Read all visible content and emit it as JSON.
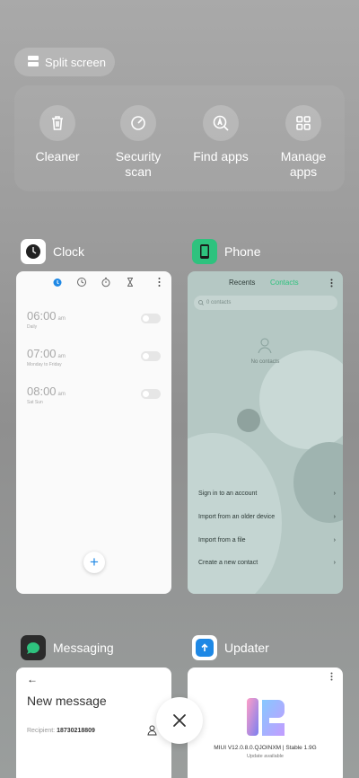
{
  "split_screen": {
    "label": "Split screen",
    "icon": "split-screen-icon"
  },
  "tools": [
    {
      "label": "Cleaner",
      "icon": "trash-icon"
    },
    {
      "label": "Security scan",
      "icon": "security-scan-icon"
    },
    {
      "label": "Find apps",
      "icon": "find-apps-icon"
    },
    {
      "label": "Manage apps",
      "icon": "grid-icon"
    }
  ],
  "apps": {
    "clock": {
      "name": "Clock",
      "alarms": [
        {
          "time": "06:00",
          "ampm": "am",
          "sub": "Daily"
        },
        {
          "time": "07:00",
          "ampm": "am",
          "sub": "Monday to Friday"
        },
        {
          "time": "08:00",
          "ampm": "am",
          "sub": "Sat Sun"
        }
      ],
      "fab": "+"
    },
    "phone": {
      "name": "Phone",
      "tab_recents": "Recents",
      "tab_contacts": "Contacts",
      "search_placeholder": "0 contacts",
      "empty": "No contacts",
      "rows": [
        "Sign in to an account",
        "Import from an older device",
        "Import from a file",
        "Create a new contact"
      ]
    },
    "messaging": {
      "name": "Messaging",
      "title": "New message",
      "recipient_label": "Recipient:",
      "recipient_value": "18730218809"
    },
    "updater": {
      "name": "Updater",
      "version": "MIUI V12.0.8.0.QJOINXM | Stable 1.9G",
      "status": "Update available"
    }
  },
  "colors": {
    "accent_green": "#2ec27e",
    "accent_blue": "#1e88e5"
  }
}
